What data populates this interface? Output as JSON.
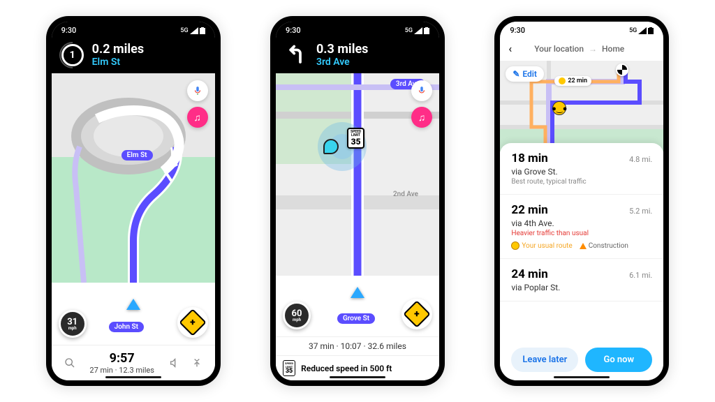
{
  "phone1": {
    "status": {
      "time": "9:30",
      "net": "5G"
    },
    "nav": {
      "exit": "1",
      "distance": "0.2 miles",
      "street": "Elm St"
    },
    "map": {
      "pill_elm": "Elm St",
      "pill_john": "John St"
    },
    "speed": {
      "value": "31",
      "unit": "mph"
    },
    "eta": {
      "arrival": "9:57",
      "sub": "27 min · 12.3 miles"
    }
  },
  "phone2": {
    "status": {
      "time": "9:30",
      "net": "5G"
    },
    "nav": {
      "distance": "0.3 miles",
      "street": "3rd Ave"
    },
    "map": {
      "pill_3rd": "3rd Ave",
      "pill_grove": "Grove St",
      "label_2nd": "2nd Ave",
      "speed_limit": "35",
      "speed_limit_label": "SPEED\nLIMIT"
    },
    "speed": {
      "value": "60",
      "unit": "mph"
    },
    "eta": {
      "row": "37 min · 10:07 · 32.6 miles"
    },
    "alert": {
      "sign": "35",
      "sign_label": "SPEED\nLIMIT",
      "text": "Reduced speed in 500 ft"
    }
  },
  "phone3": {
    "status": {
      "time": "9:30",
      "net": "5G"
    },
    "header": {
      "from": "Your location",
      "to": "Home"
    },
    "edit_label": "Edit",
    "map_eta": "22 min",
    "routes": [
      {
        "time": "18 min",
        "dist": "4.8 mi.",
        "via": "via Grove St.",
        "cond": "Best route, typical traffic",
        "cond_red": false,
        "tags": []
      },
      {
        "time": "22 min",
        "dist": "5.2 mi.",
        "via": "via 4th Ave.",
        "cond": "Heavier traffic than usual",
        "cond_red": true,
        "tags": [
          "usual",
          "construction"
        ],
        "tag_usual": "Your usual route",
        "tag_construction": "Construction"
      },
      {
        "time": "24 min",
        "dist": "6.1 mi.",
        "via": "via Poplar St.",
        "cond": "",
        "cond_red": false,
        "tags": []
      }
    ],
    "actions": {
      "secondary": "Leave later",
      "primary": "Go now"
    }
  }
}
